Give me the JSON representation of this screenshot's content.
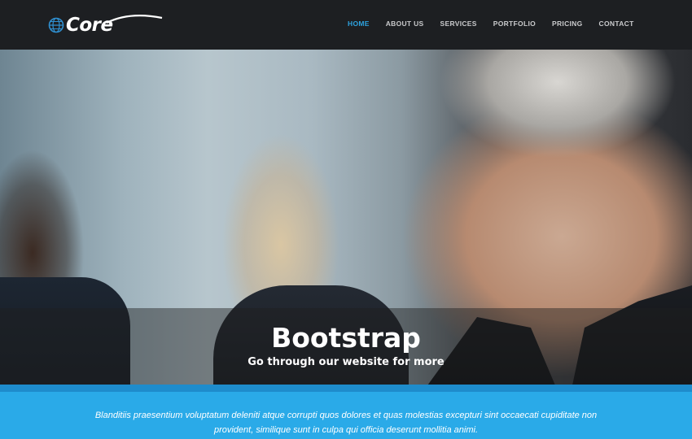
{
  "brand": {
    "name": "Core"
  },
  "nav": {
    "items": [
      {
        "label": "HOME",
        "active": true
      },
      {
        "label": "ABOUT US",
        "active": false
      },
      {
        "label": "SERVICES",
        "active": false
      },
      {
        "label": "PORTFOLIO",
        "active": false
      },
      {
        "label": "PRICING",
        "active": false
      },
      {
        "label": "CONTACT",
        "active": false
      }
    ]
  },
  "hero": {
    "title": "Bootstrap",
    "subtitle": "Go through our website for more"
  },
  "band": {
    "text": "Blanditiis praesentium voluptatum deleniti atque corrupti quos dolores et quas molestias excepturi sint occaecati cupiditate non provident, similique sunt in culpa qui officia deserunt mollitia animi."
  },
  "colors": {
    "navbar_bg": "#1d1f22",
    "nav_active": "#2da3e0",
    "band_bg": "#2aaae8",
    "divider": "#1e8ccc"
  },
  "icons": {
    "logo_icon": "globe-icon"
  }
}
